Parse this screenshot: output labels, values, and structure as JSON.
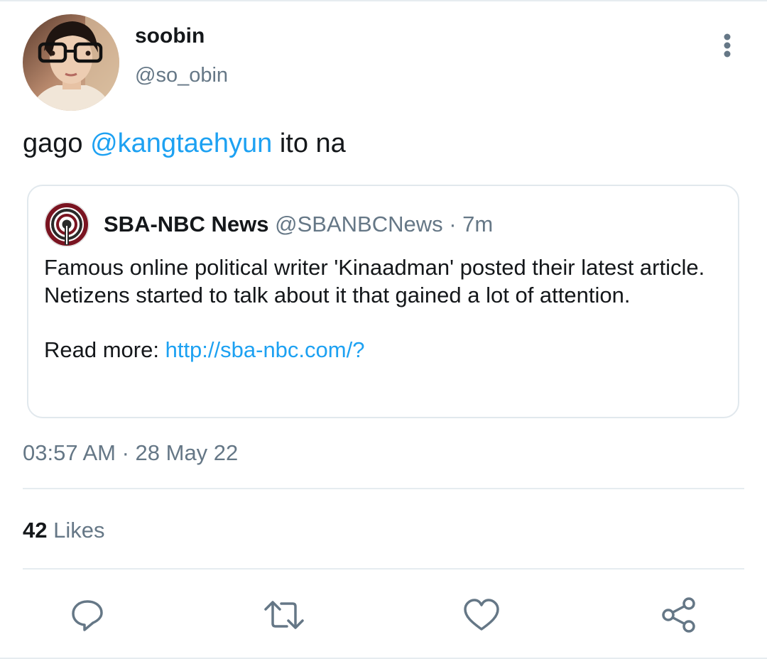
{
  "tweet": {
    "display_name": "soobin",
    "handle": "@so_obin",
    "text_before": "gago ",
    "mention": "@kangtaehyun",
    "text_after": " ito na",
    "timestamp": "03:57 AM · 28 May 22",
    "likes_count": "42",
    "likes_label": "Likes"
  },
  "quote": {
    "name": "SBA-NBC News",
    "handle": "@SBANBCNews",
    "time": "· 7m",
    "body": "Famous online political writer 'Kinaadman' posted their latest article. Netizens started to talk about it that gained a lot of attention.",
    "read_more_label": "Read more:",
    "link": "http://sba-nbc.com/?"
  },
  "icons": {
    "more": "more-vertical-icon",
    "reply": "reply-icon",
    "retweet": "retweet-icon",
    "like": "heart-icon",
    "share": "share-icon"
  },
  "colors": {
    "accent": "#1da1f2",
    "secondary_text": "#657786",
    "icon": "#657786",
    "border": "#e1e8ed"
  }
}
